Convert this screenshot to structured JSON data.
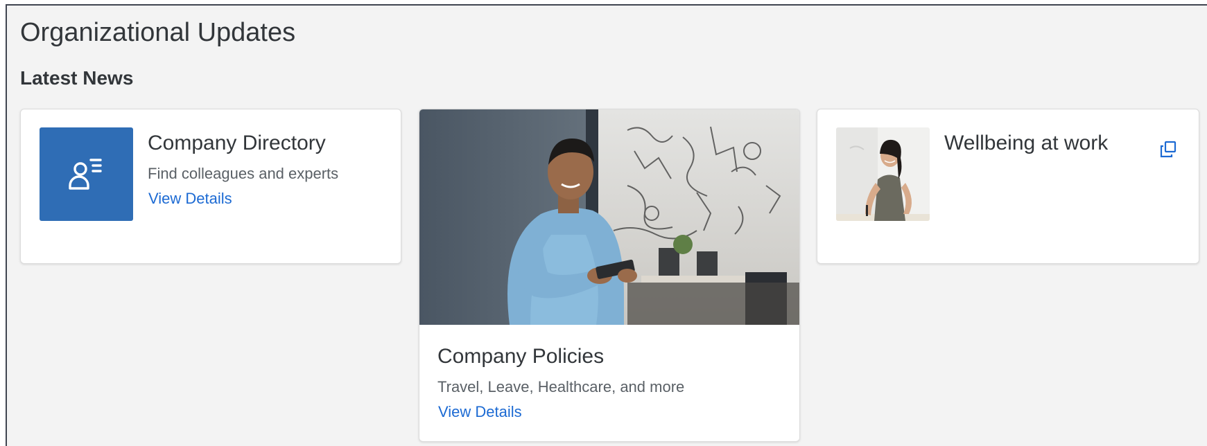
{
  "page": {
    "title": "Organizational Updates"
  },
  "section": {
    "title": "Latest News"
  },
  "cards": {
    "directory": {
      "icon": "person-list-icon",
      "title": "Company Directory",
      "description": "Find colleagues and experts",
      "link_label": "View Details"
    },
    "policies": {
      "image": "man-with-tablet-photo",
      "title": "Company Policies",
      "description": "Travel, Leave, Healthcare, and more",
      "link_label": "View Details"
    },
    "wellbeing": {
      "image": "woman-at-desk-photo",
      "title": "Wellbeing at work",
      "action_icon": "open-in-new-window-icon"
    }
  },
  "colors": {
    "accent": "#2f6db5",
    "link": "#1c6ad3",
    "background": "#f3f3f3",
    "card": "#ffffff",
    "text": "#32363a",
    "secondary_text": "#5a6066"
  }
}
